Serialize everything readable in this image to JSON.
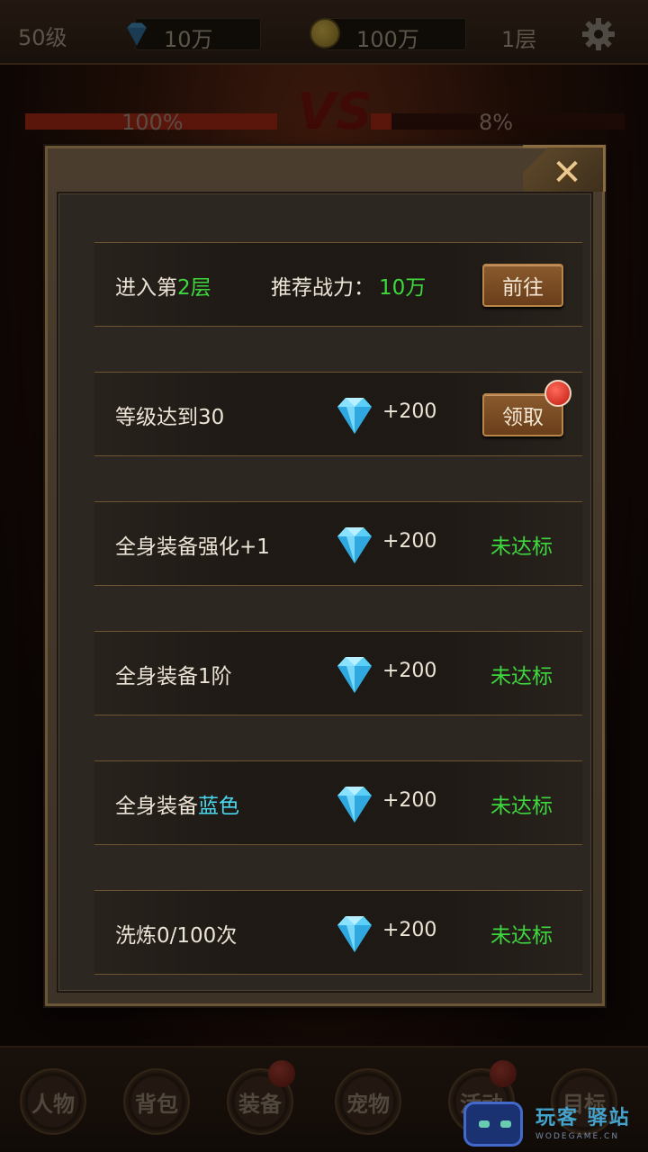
{
  "topbar": {
    "level": "50级",
    "diamonds": "10万",
    "coins": "100万",
    "floor": "1层",
    "icons": {
      "diamond": "diamond-icon",
      "coin": "coin-icon",
      "settings": "gear-icon"
    }
  },
  "battle": {
    "left_hp": "100%",
    "right_hp": "8%",
    "left_hp_fraction": 1.0,
    "right_hp_fraction": 0.08,
    "vs_label": "VS"
  },
  "dialog": {
    "close_icon": "close-icon",
    "rows": [
      {
        "label_prefix": "进入第",
        "label_highlight": "2层",
        "label_suffix": "",
        "power_label": "推荐战力：",
        "power_value": "10万",
        "action": "前往"
      },
      {
        "label": "等级达到30",
        "reward": "+200",
        "action": "领取",
        "has_badge": true
      },
      {
        "label": "全身装备强化+1",
        "reward": "+200",
        "status": "未达标"
      },
      {
        "label": "全身装备1阶",
        "reward": "+200",
        "status": "未达标"
      },
      {
        "label_prefix": "全身装备",
        "label_highlight": "蓝色",
        "reward": "+200",
        "status": "未达标"
      },
      {
        "label": "洗炼0/100次",
        "reward": "+200",
        "status": "未达标"
      }
    ]
  },
  "nav": {
    "items": [
      "人物",
      "背包",
      "装备",
      "宠物",
      "活动",
      "目标"
    ]
  },
  "watermark": {
    "title": "玩客 驿站",
    "subtitle": "WODEGAME.CN"
  },
  "colors": {
    "accent_green": "#3ed83e",
    "accent_cyan": "#4ad8f0",
    "button_brown": "#7a4a22"
  }
}
